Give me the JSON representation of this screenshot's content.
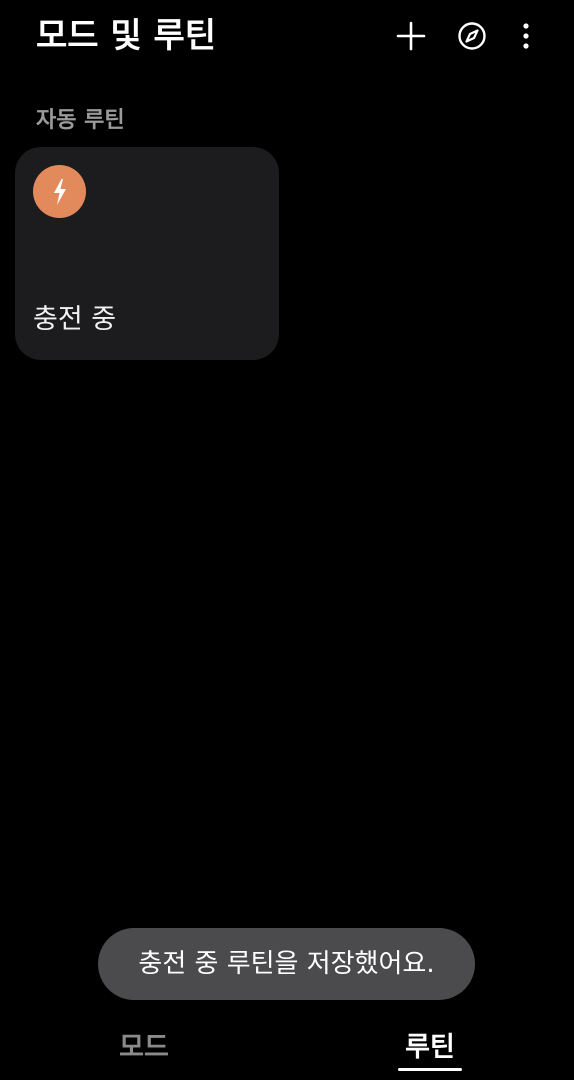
{
  "header": {
    "title": "모드 및 루틴",
    "actions": [
      {
        "icon": "plus-icon"
      },
      {
        "icon": "compass-icon"
      },
      {
        "icon": "more-vertical-icon"
      }
    ]
  },
  "section": {
    "title": "자동 루틴"
  },
  "routines": [
    {
      "name": "충전 중",
      "icon": "lightning-bolt-icon",
      "icon_color": "#e38a5c"
    }
  ],
  "toast": {
    "message": "충전 중 루틴을 저장했어요."
  },
  "bottom_tabs": [
    {
      "label": "모드",
      "selected": false
    },
    {
      "label": "루틴",
      "selected": true
    }
  ],
  "colors": {
    "background": "#000000",
    "card": "#1c1c1e",
    "toast": "#4b4b4d",
    "accent_orange": "#e38a5c",
    "muted_text": "#9b9b9b"
  }
}
